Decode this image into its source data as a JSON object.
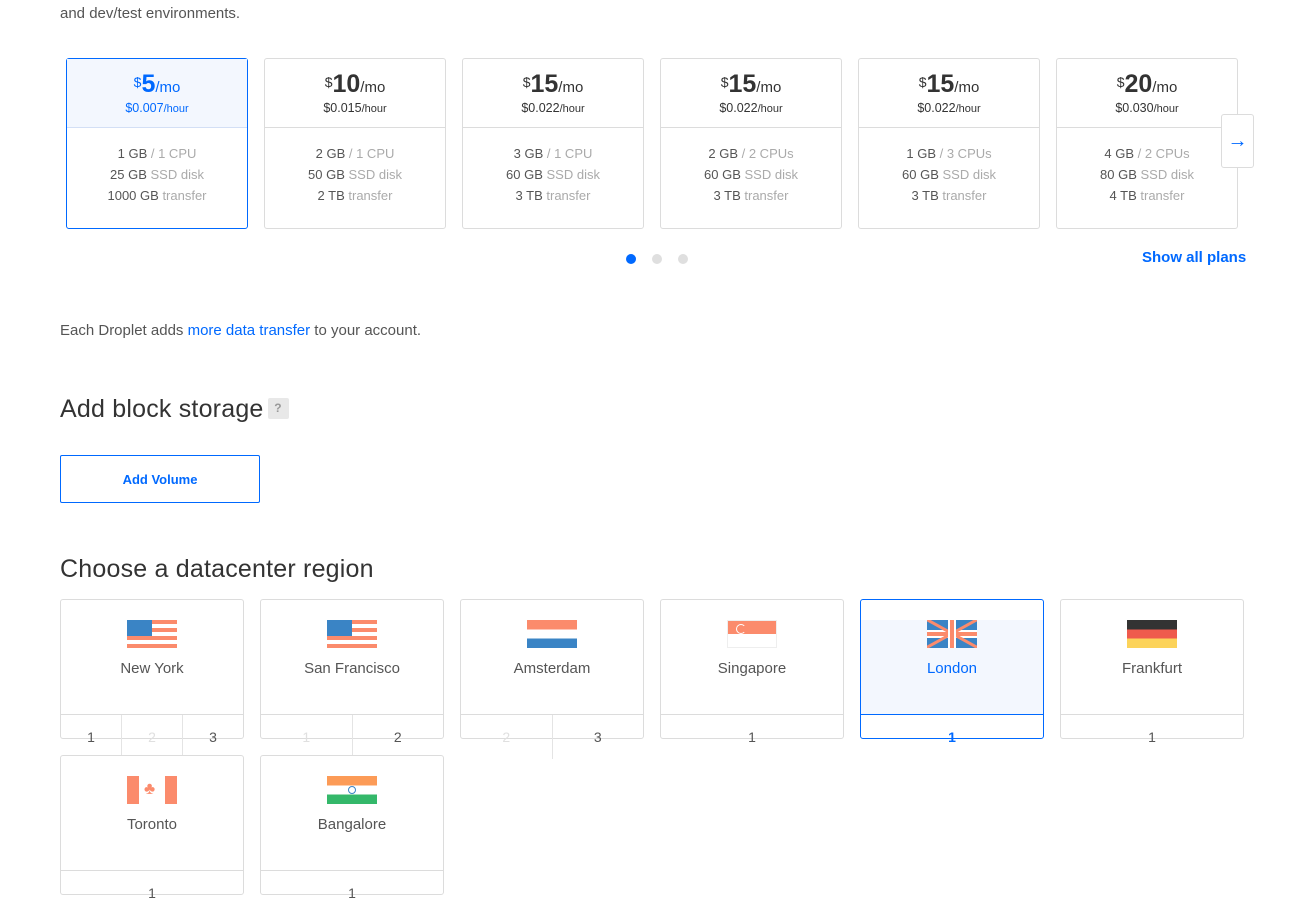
{
  "intro_text": "and dev/test environments.",
  "plans": [
    {
      "currency": "$",
      "amount": "5",
      "per": "/mo",
      "hourly": "$0.007",
      "hourly_unit": "/hour",
      "memory": "1 GB",
      "cpu": "/ 1 CPU",
      "disk_size": "25 GB",
      "disk_label": "SSD disk",
      "transfer_size": "1000 GB",
      "transfer_label": "transfer",
      "selected": true
    },
    {
      "currency": "$",
      "amount": "10",
      "per": "/mo",
      "hourly": "$0.015",
      "hourly_unit": "/hour",
      "memory": "2 GB",
      "cpu": "/ 1 CPU",
      "disk_size": "50 GB",
      "disk_label": "SSD disk",
      "transfer_size": "2 TB",
      "transfer_label": "transfer",
      "selected": false
    },
    {
      "currency": "$",
      "amount": "15",
      "per": "/mo",
      "hourly": "$0.022",
      "hourly_unit": "/hour",
      "memory": "3 GB",
      "cpu": "/ 1 CPU",
      "disk_size": "60 GB",
      "disk_label": "SSD disk",
      "transfer_size": "3 TB",
      "transfer_label": "transfer",
      "selected": false
    },
    {
      "currency": "$",
      "amount": "15",
      "per": "/mo",
      "hourly": "$0.022",
      "hourly_unit": "/hour",
      "memory": "2 GB",
      "cpu": "/ 2 CPUs",
      "disk_size": "60 GB",
      "disk_label": "SSD disk",
      "transfer_size": "3 TB",
      "transfer_label": "transfer",
      "selected": false
    },
    {
      "currency": "$",
      "amount": "15",
      "per": "/mo",
      "hourly": "$0.022",
      "hourly_unit": "/hour",
      "memory": "1 GB",
      "cpu": "/ 3 CPUs",
      "disk_size": "60 GB",
      "disk_label": "SSD disk",
      "transfer_size": "3 TB",
      "transfer_label": "transfer",
      "selected": false
    },
    {
      "currency": "$",
      "amount": "20",
      "per": "/mo",
      "hourly": "$0.030",
      "hourly_unit": "/hour",
      "memory": "4 GB",
      "cpu": "/ 2 CPUs",
      "disk_size": "80 GB",
      "disk_label": "SSD disk",
      "transfer_size": "4 TB",
      "transfer_label": "transfer",
      "selected": false
    }
  ],
  "carousel": {
    "next_icon": "arrow-right-icon",
    "next_glyph": "→",
    "page_count": 3,
    "active_page": 1
  },
  "show_all_plans": "Show all plans",
  "transfer_note": {
    "before": "Each Droplet adds ",
    "link": "more data transfer",
    "after": " to your account."
  },
  "block_storage": {
    "heading": "Add block storage",
    "help": "?",
    "button": "Add Volume"
  },
  "datacenter": {
    "heading": "Choose a datacenter region",
    "regions": [
      {
        "name": "New York",
        "flag": "us",
        "options": [
          {
            "label": "1",
            "enabled": true
          },
          {
            "label": "2",
            "enabled": false
          },
          {
            "label": "3",
            "enabled": true
          }
        ],
        "selected": false
      },
      {
        "name": "San Francisco",
        "flag": "us",
        "options": [
          {
            "label": "1",
            "enabled": false
          },
          {
            "label": "2",
            "enabled": true
          }
        ],
        "selected": false
      },
      {
        "name": "Amsterdam",
        "flag": "nl",
        "options": [
          {
            "label": "2",
            "enabled": false
          },
          {
            "label": "3",
            "enabled": true
          }
        ],
        "selected": false
      },
      {
        "name": "Singapore",
        "flag": "sg",
        "options": [
          {
            "label": "1",
            "enabled": true
          }
        ],
        "selected": false
      },
      {
        "name": "London",
        "flag": "gb",
        "options": [
          {
            "label": "1",
            "enabled": true
          }
        ],
        "selected": true
      },
      {
        "name": "Frankfurt",
        "flag": "de",
        "options": [
          {
            "label": "1",
            "enabled": true
          }
        ],
        "selected": false
      },
      {
        "name": "Toronto",
        "flag": "ca",
        "options": [
          {
            "label": "1",
            "enabled": true
          }
        ],
        "selected": false
      },
      {
        "name": "Bangalore",
        "flag": "in",
        "options": [
          {
            "label": "1",
            "enabled": true
          }
        ],
        "selected": false
      }
    ]
  },
  "colors": {
    "accent": "#0069ff",
    "border": "#dcdcdc",
    "flag_red": "#fb8b6c",
    "flag_blue": "#3a84c5"
  }
}
